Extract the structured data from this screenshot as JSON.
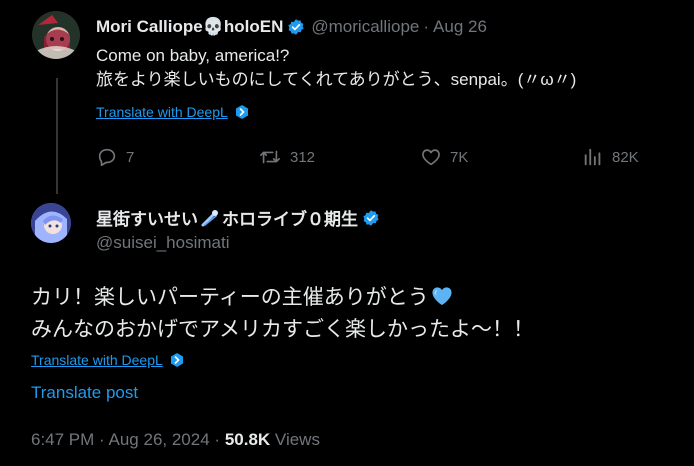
{
  "tweet1": {
    "display_name": "Mori Calliope💀holoEN",
    "handle": "@moricalliope",
    "separator": "·",
    "date": "Aug 26",
    "text_line1": "Come on baby, america!?",
    "text_line2": "旅をより楽しいものにしてくれてありがとう、senpai。(〃ω〃)",
    "translate_label": "Translate with DeepL",
    "replies": "7",
    "reposts": "312",
    "likes": "7K",
    "views": "82K"
  },
  "tweet2": {
    "display_name_part1": "星街すいせい",
    "display_name_part2": "ホロライブ０期生",
    "handle": "@suisei_hosimati",
    "text_line1": "カリ！楽しいパーティーの主催ありがとう",
    "text_line2": "みんなのおかげでアメリカすごく楽しかったよ〜！！",
    "translate_label": "Translate with DeepL",
    "translate_post": "Translate post",
    "time": "6:47 PM",
    "separator": "·",
    "date": "Aug 26, 2024",
    "views_count": "50.8K",
    "views_label": "Views"
  },
  "colors": {
    "background": "#000000",
    "text_primary": "#e7e9ea",
    "text_secondary": "#71767b",
    "accent": "#1d9bf0"
  },
  "icons": [
    "skull-emoji",
    "verified-badge-icon",
    "deepl-icon",
    "reply-icon",
    "repost-icon",
    "like-icon",
    "views-icon",
    "comet-icon",
    "blue-heart-emoji"
  ]
}
